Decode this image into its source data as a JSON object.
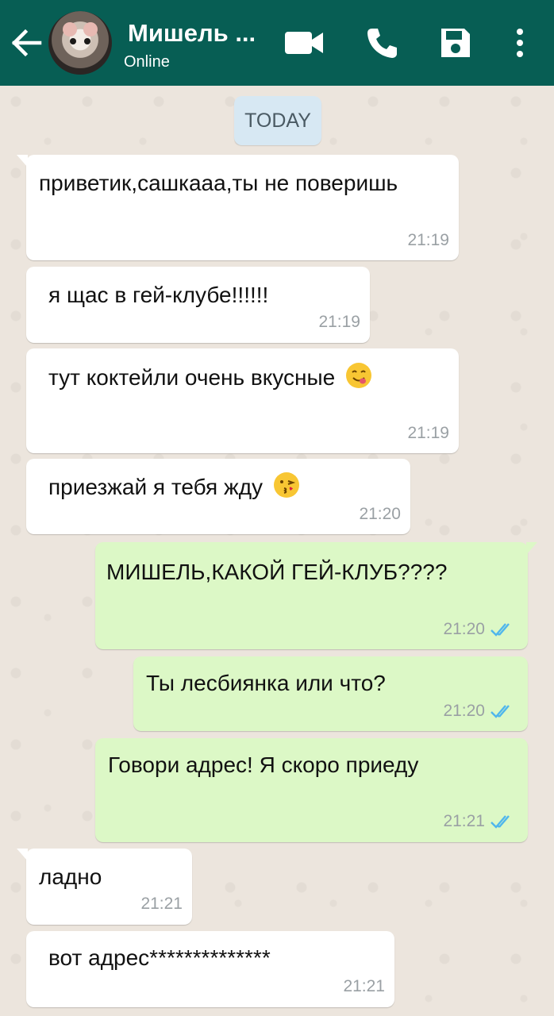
{
  "header": {
    "contact_name": "Мишель ...",
    "status": "Online",
    "icons": [
      "back-arrow-icon",
      "avatar",
      "video-call-icon",
      "phone-icon",
      "save-icon",
      "more-vert-icon"
    ]
  },
  "chat": {
    "date_label": "TODAY",
    "messages": [
      {
        "dir": "in",
        "text": "приветик,сашкааа,ты не поверишь",
        "time": "21:19"
      },
      {
        "dir": "in",
        "text": "я щас в гей-клубе!!!!!!",
        "time": "21:19"
      },
      {
        "dir": "in",
        "text": "тут коктейли очень вкусные",
        "emoji": "yum",
        "time": "21:19"
      },
      {
        "dir": "in",
        "text": "приезжай я тебя жду",
        "emoji": "kiss",
        "time": "21:20"
      },
      {
        "dir": "out",
        "text": "МИШЕЛЬ,КАКОЙ ГЕЙ-КЛУБ????",
        "time": "21:20",
        "read": true
      },
      {
        "dir": "out",
        "text": "Ты лесбиянка или что?",
        "time": "21:20",
        "read": true
      },
      {
        "dir": "out",
        "text": "Говори адрес! Я скоро приеду",
        "time": "21:21",
        "read": true
      },
      {
        "dir": "in",
        "text": "ладно",
        "time": "21:21"
      },
      {
        "dir": "in",
        "text": "вот адрес**************",
        "time": "21:21"
      }
    ]
  },
  "colors": {
    "header_bg": "#075e54",
    "chat_bg": "#ece5dd",
    "incoming_bubble": "#ffffff",
    "outgoing_bubble": "#dcf8c6",
    "read_ticks": "#4fb6ec"
  }
}
